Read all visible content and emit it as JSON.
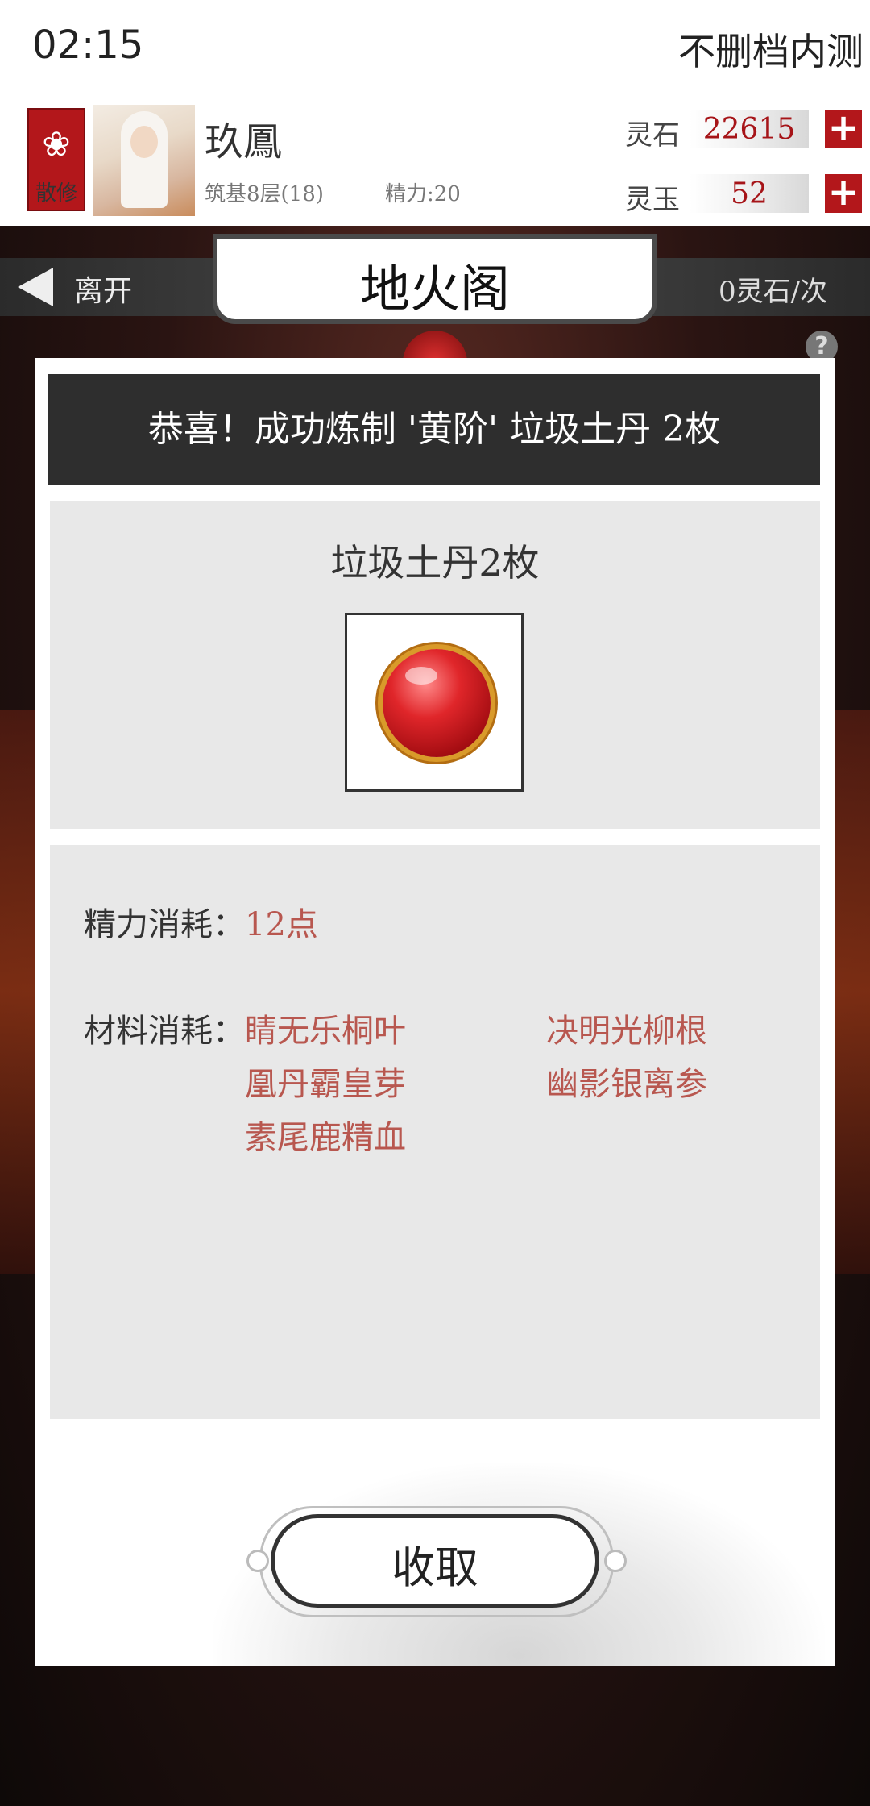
{
  "status": {
    "time": "02:15",
    "build": "不删档内测"
  },
  "player": {
    "sect_badge": "散修",
    "name": "玖鳳",
    "realm": "筑基8层(18)",
    "energy": "精力:20"
  },
  "currencies": [
    {
      "name": "灵石",
      "value": "22615"
    },
    {
      "name": "灵玉",
      "value": "52"
    }
  ],
  "nav": {
    "leave": "离开",
    "title": "地火阁",
    "cost": "0灵石/次",
    "help": "?"
  },
  "result": {
    "banner": "恭喜！成功炼制 '黄阶' 垃圾土丹 2枚",
    "item_title": "垃圾土丹2枚",
    "energy_label": "精力消耗：",
    "energy_value": "12点",
    "materials_label": "材料消耗：",
    "materials": [
      "睛无乐桐叶",
      "决明光柳根",
      "凰丹霸皇芽",
      "幽影银离参",
      "素尾鹿精血"
    ],
    "collect": "收取"
  },
  "colors": {
    "accent_red": "#b3171b",
    "material_text": "#b8574f",
    "banner_bg": "#2e2e2e"
  }
}
